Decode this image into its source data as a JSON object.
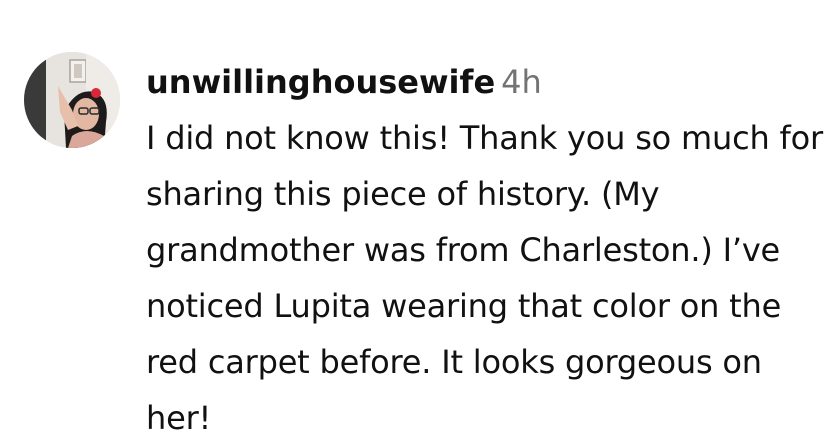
{
  "comment": {
    "username": "unwillinghousewife",
    "timestamp": "4h",
    "text": "I did not know this! Thank you so much for sharing this piece of history. (My grandmother was from Charleston.) I’ve noticed Lupita wearing that color on the red carpet before. It looks gorgeous on her!",
    "avatar_icon": "user-profile-photo"
  }
}
